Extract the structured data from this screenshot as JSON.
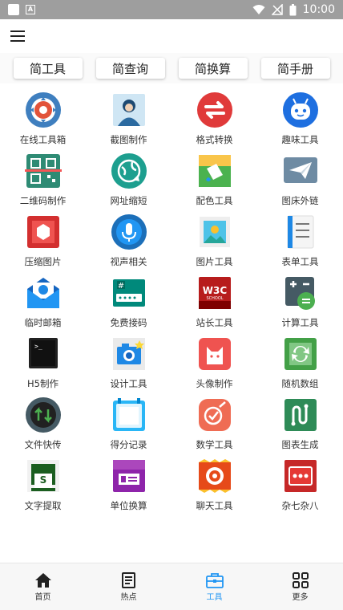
{
  "status": {
    "time": "10:00",
    "a_icon_letter": "A"
  },
  "tabs": [
    "简工具",
    "简查询",
    "简换算",
    "简手册"
  ],
  "tools": [
    {
      "label": "在线工具箱",
      "icon": "settings-gear-icon"
    },
    {
      "label": "截图制作",
      "icon": "portrait-photo-icon"
    },
    {
      "label": "格式转换",
      "icon": "swap-arrows-icon"
    },
    {
      "label": "趣味工具",
      "icon": "robot-face-icon"
    },
    {
      "label": "二维码制作",
      "icon": "qr-scan-icon"
    },
    {
      "label": "网址缩短",
      "icon": "globe-link-icon"
    },
    {
      "label": "配色工具",
      "icon": "palette-bucket-icon"
    },
    {
      "label": "图床外链",
      "icon": "paper-plane-icon"
    },
    {
      "label": "压缩图片",
      "icon": "hexagon-compress-icon"
    },
    {
      "label": "视声相关",
      "icon": "microphone-icon"
    },
    {
      "label": "图片工具",
      "icon": "landscape-image-icon"
    },
    {
      "label": "表单工具",
      "icon": "form-list-icon"
    },
    {
      "label": "临时邮箱",
      "icon": "mail-envelope-icon"
    },
    {
      "label": "免费接码",
      "icon": "sms-code-icon"
    },
    {
      "label": "站长工具",
      "icon": "w3c-school-icon"
    },
    {
      "label": "计算工具",
      "icon": "calculator-icon"
    },
    {
      "label": "H5制作",
      "icon": "terminal-icon"
    },
    {
      "label": "设计工具",
      "icon": "camera-icon"
    },
    {
      "label": "头像制作",
      "icon": "cat-avatar-icon"
    },
    {
      "label": "随机数组",
      "icon": "refresh-icon"
    },
    {
      "label": "文件快传",
      "icon": "transfer-arrows-icon"
    },
    {
      "label": "得分记录",
      "icon": "score-board-icon"
    },
    {
      "label": "数学工具",
      "icon": "check-badge-icon"
    },
    {
      "label": "图表生成",
      "icon": "chart-path-icon"
    },
    {
      "label": "文字提取",
      "icon": "text-extract-icon"
    },
    {
      "label": "单位换算",
      "icon": "unit-convert-icon"
    },
    {
      "label": "聊天工具",
      "icon": "chat-gear-icon"
    },
    {
      "label": "杂七杂八",
      "icon": "misc-dots-icon"
    }
  ],
  "nav": [
    {
      "label": "首页",
      "icon": "home-icon"
    },
    {
      "label": "热点",
      "icon": "news-icon"
    },
    {
      "label": "工具",
      "icon": "toolbox-icon"
    },
    {
      "label": "更多",
      "icon": "grid-more-icon"
    }
  ],
  "nav_active_index": 2,
  "colors": {
    "accent": "#2196f3",
    "status_bar": "#9e9e9e"
  }
}
